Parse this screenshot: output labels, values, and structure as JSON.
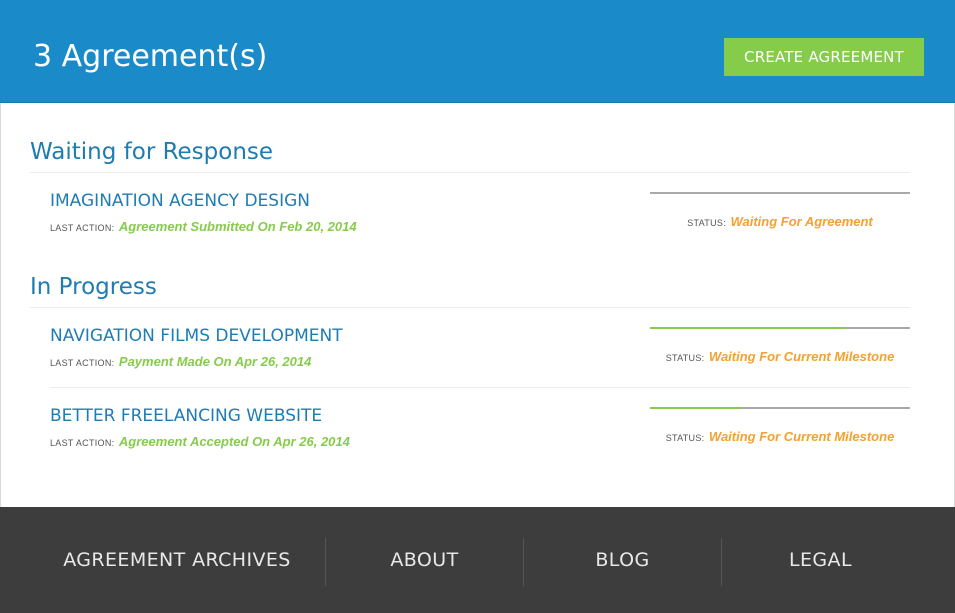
{
  "header": {
    "title": "3 Agreement(s)",
    "create_button": "CREATE AGREEMENT"
  },
  "labels": {
    "last_action": "LAST ACTION:",
    "status": "STATUS:"
  },
  "sections": [
    {
      "title": "Waiting for Response",
      "items": [
        {
          "name": "IMAGINATION AGENCY DESIGN",
          "last_action": "Agreement Submitted On Feb 20, 2014",
          "status": "Waiting For Agreement",
          "progress": 0
        }
      ]
    },
    {
      "title": "In Progress",
      "items": [
        {
          "name": "NAVIGATION FILMS DEVELOPMENT",
          "last_action": "Payment Made On Apr 26, 2014",
          "status": "Waiting For Current Milestone",
          "progress": 0.75
        },
        {
          "name": "BETTER FREELANCING WEBSITE",
          "last_action": "Agreement Accepted On Apr 26, 2014",
          "status": "Waiting For Current Milestone",
          "progress": 0.35
        }
      ]
    }
  ],
  "footer": {
    "items": [
      "AGREEMENT ARCHIVES",
      "ABOUT",
      "BLOG",
      "LEGAL"
    ]
  },
  "colors": {
    "header_bg": "#1a8bc8",
    "accent_green": "#85cc4a",
    "status_orange": "#f5a030",
    "link_blue": "#1f7cb2",
    "footer_bg": "#3d3d3d"
  }
}
